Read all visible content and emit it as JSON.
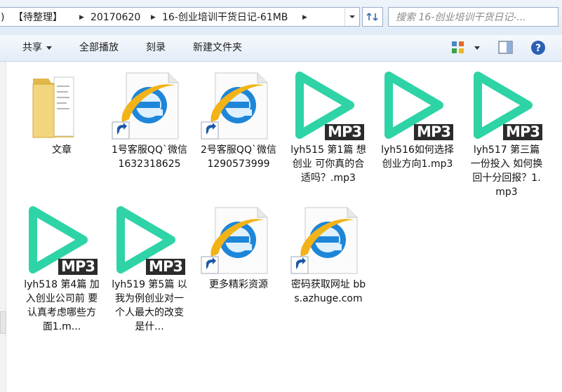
{
  "address": {
    "crumbs": [
      "【待整理】",
      "20170620",
      "16-创业培训干货日记-61MB"
    ],
    "search_placeholder": "搜索 16-创业培训干货日记-..."
  },
  "toolbar": {
    "share": "共享",
    "play_all": "全部播放",
    "burn": "刻录",
    "new_folder": "新建文件夹"
  },
  "files": [
    {
      "label": "文章",
      "icon": "folder-icon"
    },
    {
      "label": "1号客服QQ`微信 1632318625",
      "icon": "ie-shortcut-icon"
    },
    {
      "label": "2号客服QQ`微信 1290573999",
      "icon": "ie-shortcut-icon"
    },
    {
      "label": "lyh515 第1篇 想创业 可你真的合适吗？.mp3",
      "icon": "mp3-icon",
      "badge": "MP3"
    },
    {
      "label": "lyh516如何选择创业方向1.mp3",
      "icon": "mp3-icon",
      "badge": "MP3"
    },
    {
      "label": "lyh517 第三篇 一份投入 如何换回十分回报？1.mp3",
      "icon": "mp3-icon",
      "badge": "MP3"
    },
    {
      "label": "lyh518 第4篇 加入创业公司前 要认真考虑哪些方面1.m...",
      "icon": "mp3-icon",
      "badge": "MP3"
    },
    {
      "label": "lyh519 第5篇 以我为例创业对一个人最大的改变是什...",
      "icon": "mp3-icon",
      "badge": "MP3"
    },
    {
      "label": "更多精彩资源",
      "icon": "ie-shortcut-icon"
    },
    {
      "label": "密码获取网址 bbs.azhuge.com",
      "icon": "ie-shortcut-icon"
    }
  ],
  "colors": {
    "mp3_play": "#2ed3a6",
    "mp3_badge": "#2b2b2b",
    "ie_blue": "#1e86d8",
    "ie_ring": "#f2b318",
    "folder": "#ebc766"
  }
}
